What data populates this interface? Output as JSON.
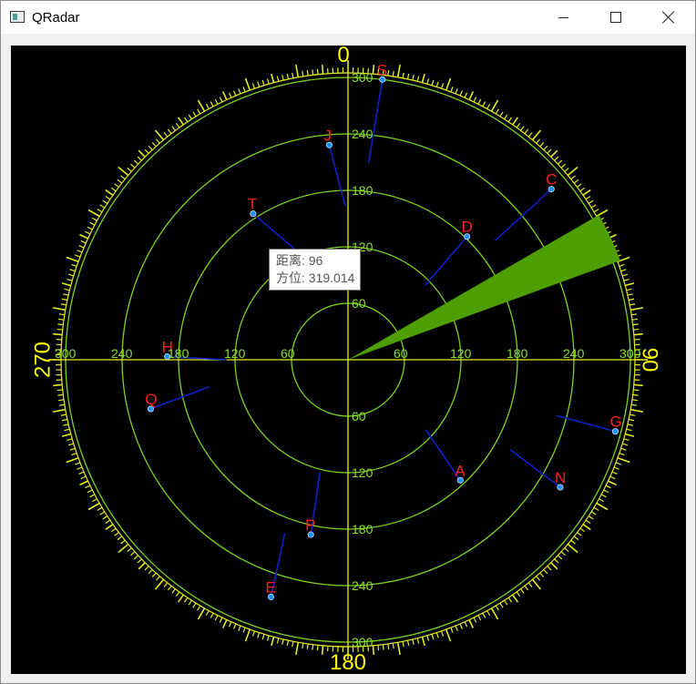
{
  "window": {
    "title": "QRadar",
    "icon": "app-window-icon"
  },
  "titlebar_buttons": [
    {
      "name": "minimize-button",
      "icon": "minimize-icon"
    },
    {
      "name": "maximize-button",
      "icon": "maximize-icon"
    },
    {
      "name": "close-button",
      "icon": "close-icon"
    }
  ],
  "radar": {
    "compass_labels": [
      "0",
      "90",
      "180",
      "270"
    ],
    "range_labels": [
      "60",
      "120",
      "180",
      "240",
      "300"
    ],
    "max_range": 300,
    "sweep": {
      "from_deg": 60,
      "to_deg": 70
    },
    "targets": [
      {
        "label": "S",
        "distance": 300,
        "bearing": 7,
        "trail_distance": 210,
        "trail_bearing": 6
      },
      {
        "label": "J",
        "distance": 229,
        "bearing": 355,
        "trail_distance": 163,
        "trail_bearing": 359
      },
      {
        "label": "T",
        "distance": 185,
        "bearing": 327,
        "trail_distance": 118,
        "trail_bearing": 337
      },
      {
        "label": "D",
        "distance": 182,
        "bearing": 44,
        "trail_distance": 114,
        "trail_bearing": 46
      },
      {
        "label": "C",
        "distance": 282,
        "bearing": 50,
        "trail_distance": 201,
        "trail_bearing": 51
      },
      {
        "label": "H",
        "distance": 192,
        "bearing": 271,
        "trail_distance": 129,
        "trail_bearing": 270
      },
      {
        "label": "Q",
        "distance": 216,
        "bearing": 256,
        "trail_distance": 150,
        "trail_bearing": 259
      },
      {
        "label": "G",
        "distance": 294,
        "bearing": 105,
        "trail_distance": 229,
        "trail_bearing": 105
      },
      {
        "label": "N",
        "distance": 263,
        "bearing": 121,
        "trail_distance": 197,
        "trail_bearing": 119
      },
      {
        "label": "A",
        "distance": 175,
        "bearing": 137,
        "trail_distance": 111,
        "trail_bearing": 132
      },
      {
        "label": "P",
        "distance": 190,
        "bearing": 192,
        "trail_distance": 123,
        "trail_bearing": 194
      },
      {
        "label": "E",
        "distance": 265,
        "bearing": 198,
        "trail_distance": 196,
        "trail_bearing": 200
      }
    ]
  },
  "tooltip": {
    "line1": "距离: 96",
    "line2": "方位: 319.014"
  },
  "colors": {
    "background": "#000000",
    "grid": "#7cd31c",
    "scale": "#e4ee1a",
    "compass_text": "#ffff00",
    "range_text": "#8be02a",
    "sweep": "#4f9e00",
    "target_label": "#ff1e1e",
    "target_dot": "#1e90ff",
    "trail": "#1020c8"
  }
}
